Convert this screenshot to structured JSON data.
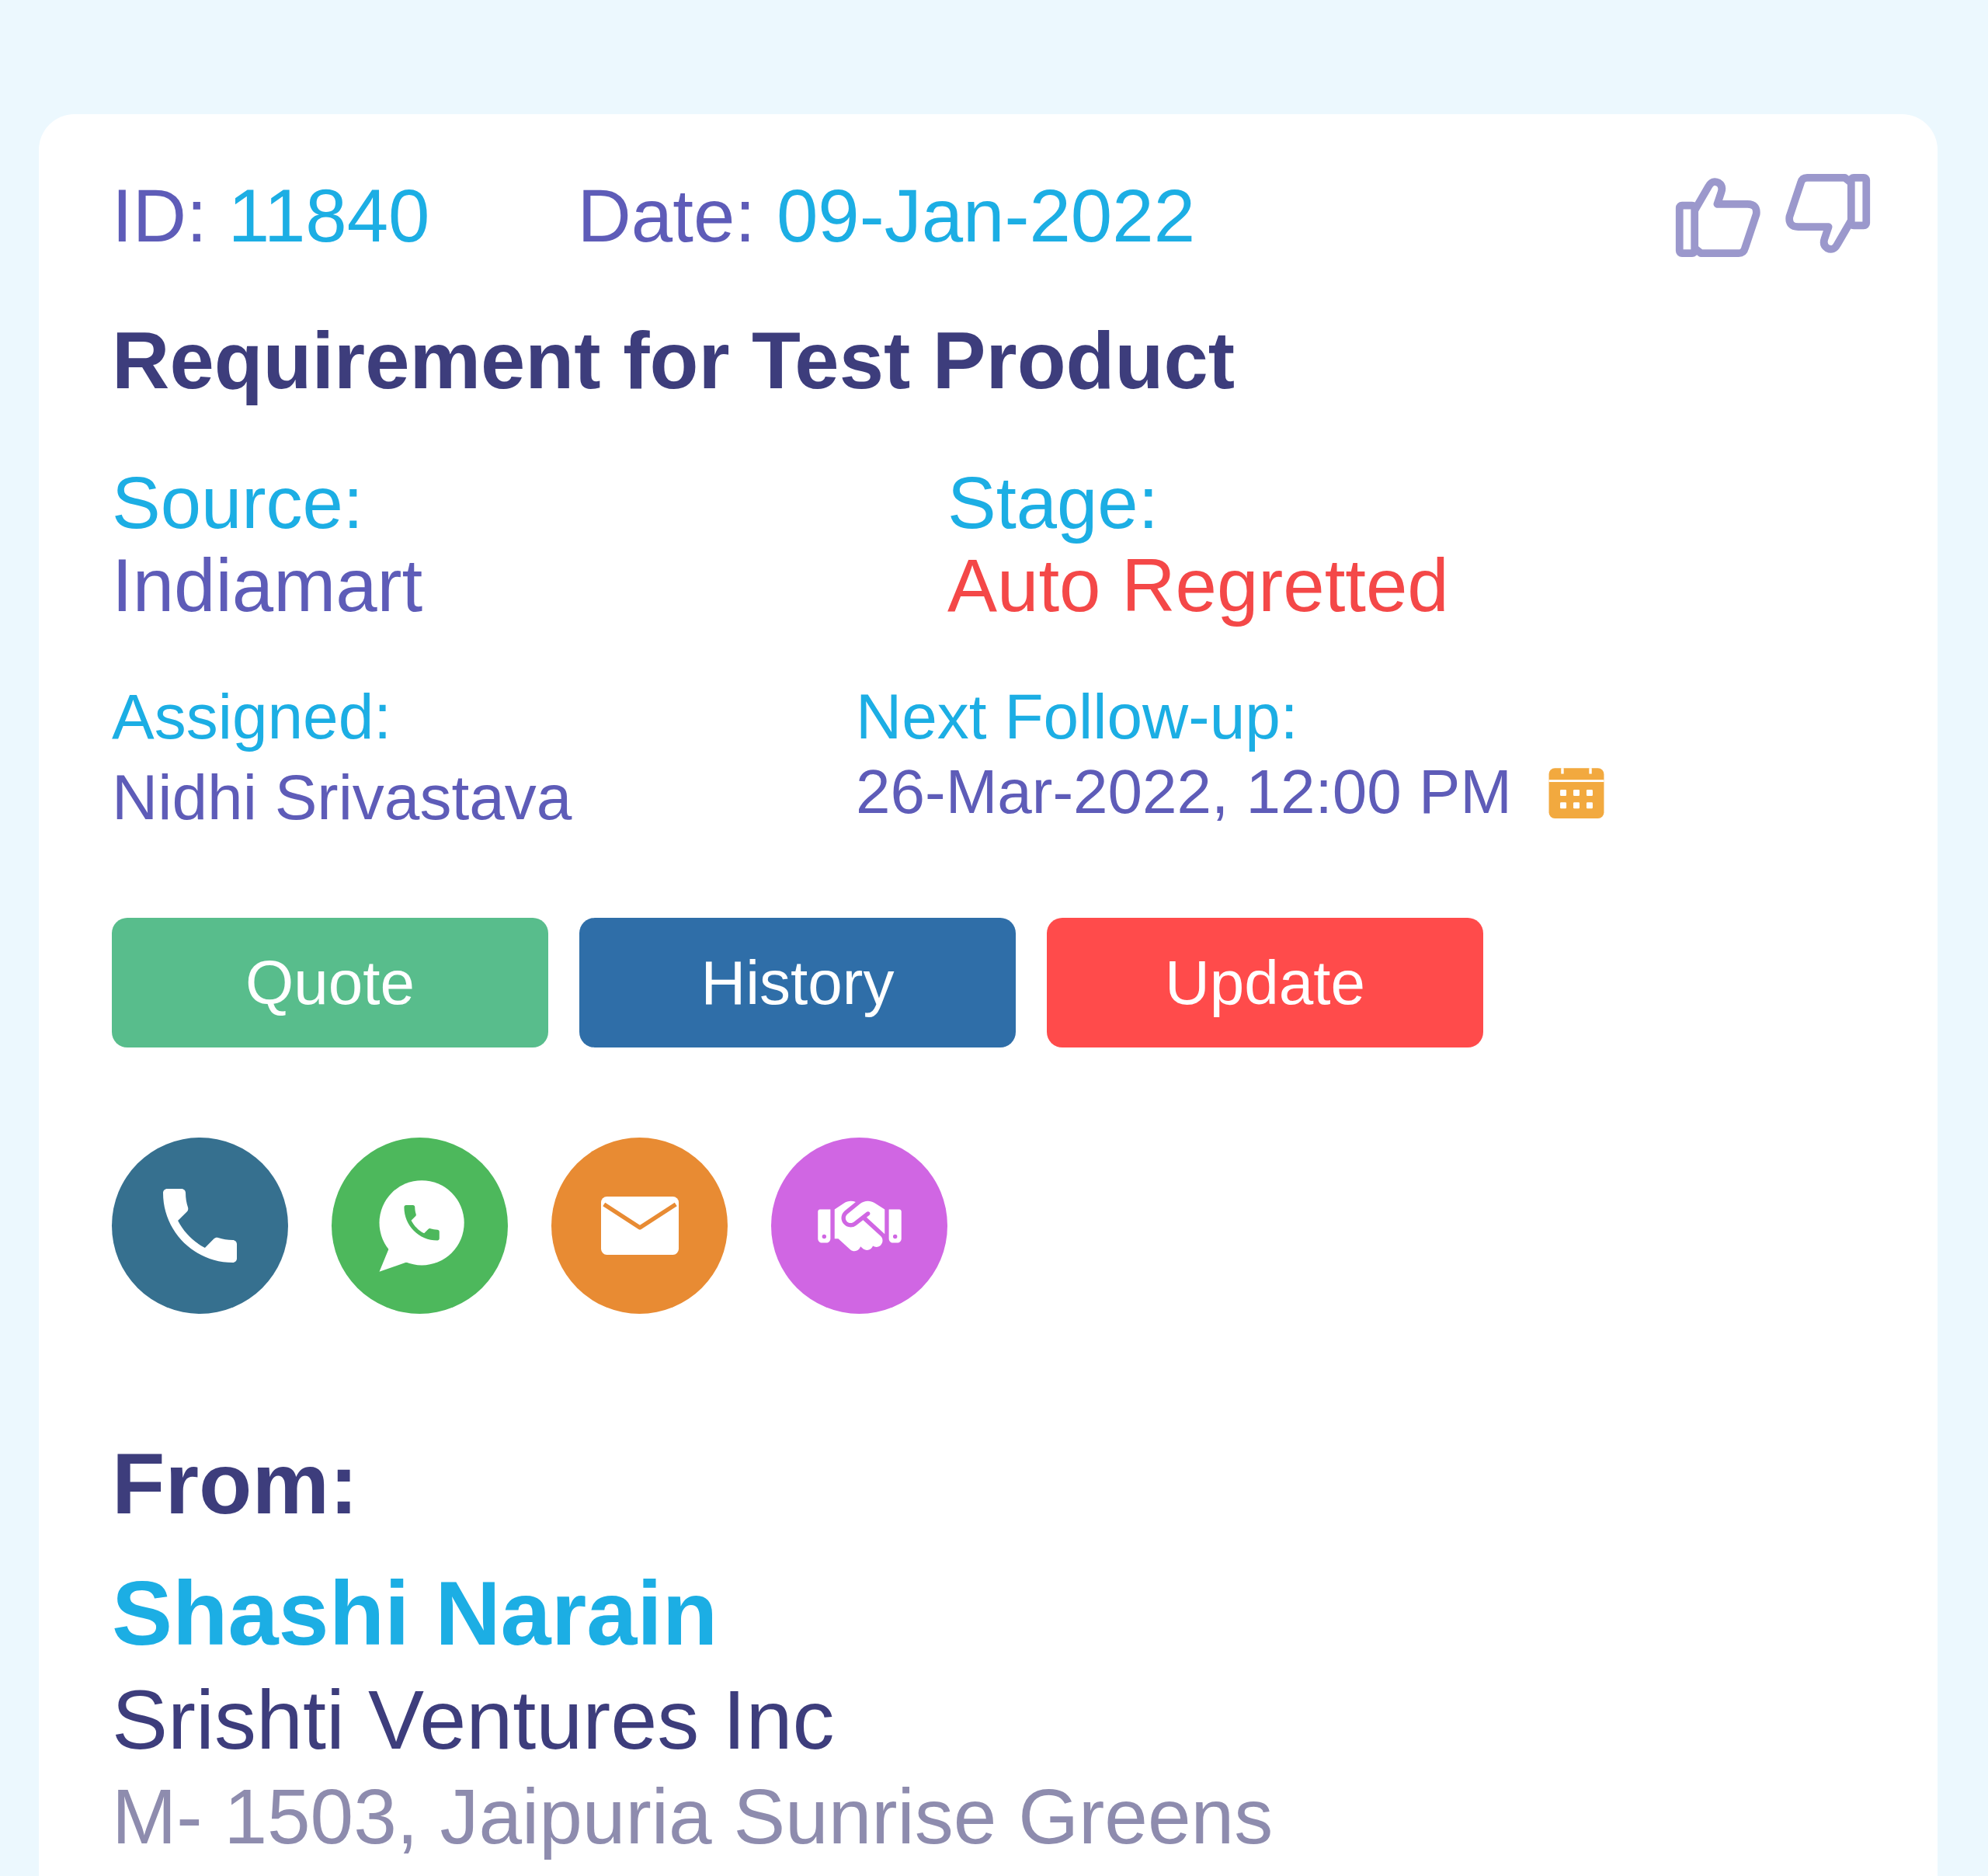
{
  "header": {
    "id": {
      "label": "ID:",
      "value": "11840"
    },
    "date": {
      "label": "Date:",
      "value": "09-Jan-2022"
    }
  },
  "title": "Requirement for Test Product",
  "source": {
    "label": "Source:",
    "value": "Indiamart"
  },
  "stage": {
    "label": "Stage:",
    "value": "Auto Regretted"
  },
  "assigned": {
    "label": "Assigned:",
    "value": "Nidhi Srivastava"
  },
  "next_follow_up": {
    "label": "Next Follow-up:",
    "value": "26-Mar-2022, 12:00 PM"
  },
  "buttons": [
    {
      "label": "Quote",
      "color": "#58bd8c"
    },
    {
      "label": "History",
      "color": "#2f6ea8"
    },
    {
      "label": "Update",
      "color": "#ff4b4b"
    }
  ],
  "contact_actions": [
    {
      "kind": "phone",
      "color": "#36708f"
    },
    {
      "kind": "chat",
      "color": "#4db85c"
    },
    {
      "kind": "email",
      "color": "#e88b33"
    },
    {
      "kind": "handshake",
      "color": "#d066e3"
    }
  ],
  "from": {
    "label": "From:",
    "name": "Shashi Narain",
    "company": "Srishti Ventures Inc",
    "address": "M- 1503, Jaipuria Sunrise Greens"
  }
}
